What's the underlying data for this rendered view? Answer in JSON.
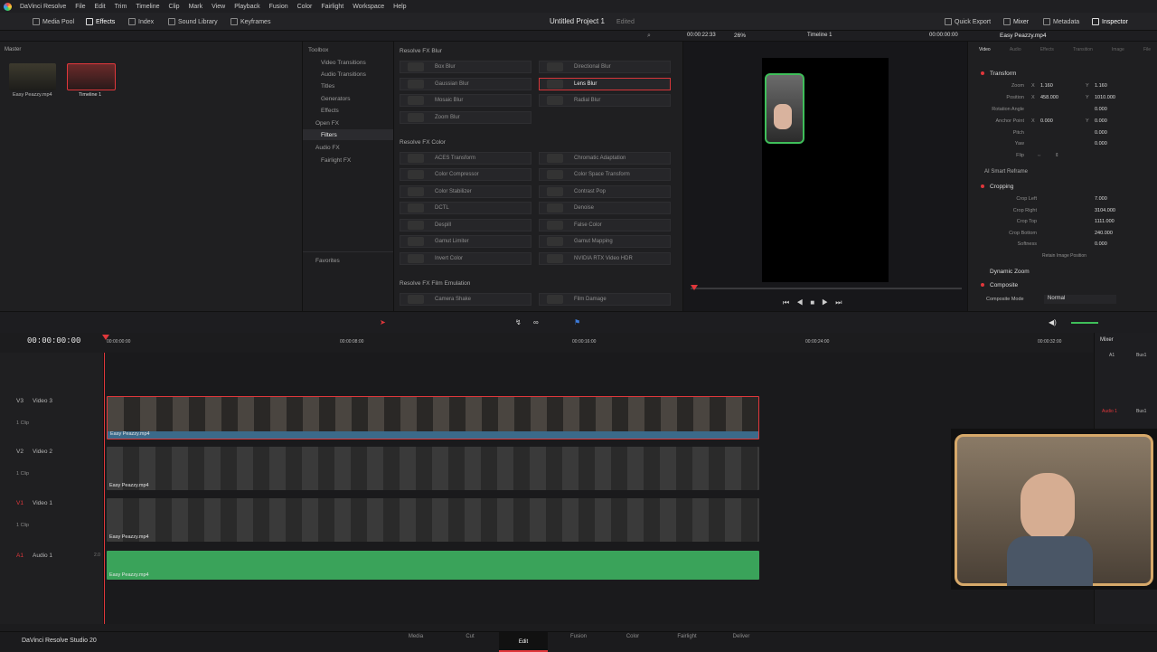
{
  "menubar": {
    "app": "DaVinci Resolve",
    "items": [
      "File",
      "Edit",
      "Trim",
      "Timeline",
      "Clip",
      "Mark",
      "View",
      "Playback",
      "Fusion",
      "Color",
      "Fairlight",
      "Workspace",
      "Help"
    ]
  },
  "toolbar": {
    "media_pool": "Media Pool",
    "effects": "Effects",
    "index": "Index",
    "sound_library": "Sound Library",
    "keyframes": "Keyframes",
    "project_title": "Untitled Project 1",
    "project_status": "Edited",
    "quick_export": "Quick Export",
    "mixer": "Mixer",
    "metadata": "Metadata",
    "inspector": "Inspector"
  },
  "media_pool": {
    "bin": "Master",
    "items": [
      {
        "name": "Easy Peazzy.mp4"
      },
      {
        "name": "Timeline 1"
      }
    ]
  },
  "fx_tree": {
    "items": [
      {
        "label": "Toolbox",
        "expanded": true
      },
      {
        "label": "Video Transitions"
      },
      {
        "label": "Audio Transitions"
      },
      {
        "label": "Titles"
      },
      {
        "label": "Generators"
      },
      {
        "label": "Effects"
      },
      {
        "label": "Open FX"
      },
      {
        "label": "Filters",
        "selected": true
      },
      {
        "label": "Audio FX"
      },
      {
        "label": "Fairlight FX"
      }
    ],
    "favorites": "Favorites"
  },
  "fx_list": {
    "sections": [
      {
        "title": "Resolve FX Blur",
        "items": [
          "Box Blur",
          "Directional Blur",
          "Gaussian Blur",
          "Lens Blur",
          "Mosaic Blur",
          "Radial Blur",
          "Zoom Blur"
        ],
        "selected": "Lens Blur"
      },
      {
        "title": "Resolve FX Color",
        "items": [
          "ACES Transform",
          "Chromatic Adaptation",
          "Color Compressor",
          "Color Space Transform",
          "Color Stabilizer",
          "Contrast Pop",
          "DCTL",
          "Denoise",
          "Despill",
          "False Color",
          "Gamut Limiter",
          "Gamut Mapping",
          "Invert Color",
          "NVIDIA RTX Video HDR"
        ]
      },
      {
        "title": "Resolve FX Film Emulation",
        "items": [
          "Camera Shake",
          "Film Damage"
        ]
      }
    ]
  },
  "viewer": {
    "zoom": "26%",
    "timecode_left": "00:00:22:33",
    "timeline_name": "Timeline 1",
    "timecode_right": "00:00:00:00"
  },
  "inspector": {
    "clip_name": "Easy Peazzy.mp4",
    "tabs": [
      "Video",
      "Audio",
      "Effects",
      "Transition",
      "Image",
      "File"
    ],
    "transform": {
      "title": "Transform",
      "zoom_x": "1.160",
      "zoom_y": "1.160",
      "position_x": "458.000",
      "position_y": "1010.000",
      "rotation_angle": "0.000",
      "anchor_x": "0.000",
      "anchor_y": "0.000",
      "pitch": "0.000",
      "yaw": "0.000",
      "labels": {
        "zoom": "Zoom",
        "position": "Position",
        "rotation": "Rotation Angle",
        "anchor": "Anchor Point",
        "pitch": "Pitch",
        "yaw": "Yaw",
        "flip": "Flip"
      }
    },
    "ai_smart_reframe": "AI Smart Reframe",
    "cropping": {
      "title": "Cropping",
      "crop_left": "7.000",
      "crop_right": "3104.000",
      "crop_top": "1111.000",
      "crop_bottom": "240.000",
      "softness": "0.000",
      "labels": {
        "left": "Crop Left",
        "right": "Crop Right",
        "top": "Crop Top",
        "bottom": "Crop Bottom",
        "softness": "Softness"
      },
      "retain": "Retain Image Position"
    },
    "dynamic_zoom": "Dynamic Zoom",
    "composite": {
      "title": "Composite",
      "mode_label": "Composite Mode",
      "mode": "Normal"
    }
  },
  "timeline": {
    "timecode": "00:00:00:00",
    "ruler": [
      "00:00:00:00",
      "00:00:08:00",
      "00:00:16:00",
      "00:00:24:00",
      "00:00:32:00"
    ],
    "tracks": [
      {
        "id": "V3",
        "name": "Video 3",
        "clips": "1 Clip",
        "clip_name": "Easy Peazzy.mp4"
      },
      {
        "id": "V2",
        "name": "Video 2",
        "clips": "1 Clip",
        "clip_name": "Easy Peazzy.mp4"
      },
      {
        "id": "V1",
        "name": "Video 1",
        "clips": "1 Clip",
        "clip_name": "Easy Peazzy.mp4"
      },
      {
        "id": "A1",
        "name": "Audio 1",
        "level": "2.0",
        "clip_name": "Easy Peazzy.mp4"
      }
    ]
  },
  "mixer": {
    "title": "Mixer",
    "a1": "A1",
    "bus1": "Bus1",
    "audio1": "Audio 1"
  },
  "pagebar": {
    "product": "DaVinci Resolve Studio 20",
    "pages": [
      "Media",
      "Cut",
      "Edit",
      "Fusion",
      "Color",
      "Fairlight",
      "Deliver"
    ],
    "active": "Edit"
  },
  "colors": {
    "accent": "#e0373b",
    "audio": "#3aa35a",
    "selected_fx_border": "#d6363a"
  }
}
